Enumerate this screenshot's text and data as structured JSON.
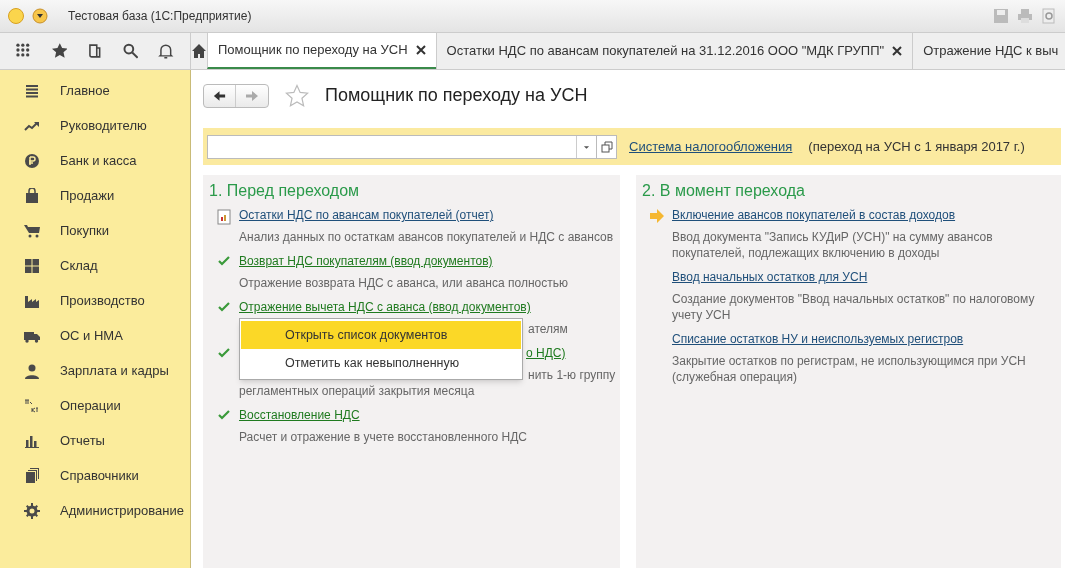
{
  "window": {
    "title": "Тестовая база  (1С:Предприятие)"
  },
  "tabs": [
    {
      "label": "Помощник по переходу на УСН",
      "selected": true,
      "closable": true
    },
    {
      "label": "Остатки НДС по авансам покупателей на 31.12.2016 ООО \"МДК ГРУПП\"",
      "selected": false,
      "closable": true
    },
    {
      "label": "Отражение НДС к выч",
      "selected": false,
      "closable": false
    }
  ],
  "sidebar": {
    "items": [
      {
        "label": "Главное"
      },
      {
        "label": "Руководителю"
      },
      {
        "label": "Банк и касса"
      },
      {
        "label": "Продажи"
      },
      {
        "label": "Покупки"
      },
      {
        "label": "Склад"
      },
      {
        "label": "Производство"
      },
      {
        "label": "ОС и НМА"
      },
      {
        "label": "Зарплата и кадры"
      },
      {
        "label": "Операции"
      },
      {
        "label": "Отчеты"
      },
      {
        "label": "Справочники"
      },
      {
        "label": "Администрирование"
      }
    ]
  },
  "page": {
    "title": "Помощник по переходу на УСН",
    "tax_link": "Система налогообложения",
    "note": "(переход на УСН с 1 января 2017 г.)"
  },
  "sections": [
    {
      "title": "1. Перед переходом",
      "steps": [
        {
          "kind": "report",
          "link": "Остатки НДС по авансам покупателей (отчет)",
          "description": "Анализ данных по остаткам авансов покупателей и НДС с авансов"
        },
        {
          "kind": "done",
          "link": "Возврат НДС покупателям (ввод документов)",
          "description": "Отражение возврата НДС с аванса, или аванса полностью"
        },
        {
          "kind": "done",
          "link": "Отражение вычета НДС с аванса (ввод документов)",
          "description": "ателям"
        },
        {
          "kind": "done",
          "link": "о НДС)",
          "description": "нить 1-ю группу",
          "description2": "регламентных операций закрытия месяца"
        },
        {
          "kind": "done",
          "link": "Восстановление НДС",
          "description": "Расчет и отражение в учете восстановленного НДС"
        }
      ]
    },
    {
      "title": "2. В момент перехода",
      "steps": [
        {
          "kind": "current",
          "link": "Включение авансов покупателей в состав доходов",
          "description": "Ввод документа \"Запись КУДиР (УСН)\" на сумму авансов покупателей, подлежащих включению в доходы"
        },
        {
          "kind": "none",
          "link": "Ввод начальных остатков для УСН",
          "description": "Создание документов \"Ввод начальных остатков\" по налоговому учету УСН"
        },
        {
          "kind": "none",
          "link": "Списание остатков НУ и неиспользуемых регистров",
          "description": "Закрытие остатков по  регистрам, не использующимся при УСН (служебная операция)"
        }
      ]
    }
  ],
  "context_menu": {
    "items": [
      {
        "label": "Открыть список документов",
        "selected": true
      },
      {
        "label": "Отметить как невыполненную",
        "selected": false
      }
    ]
  }
}
